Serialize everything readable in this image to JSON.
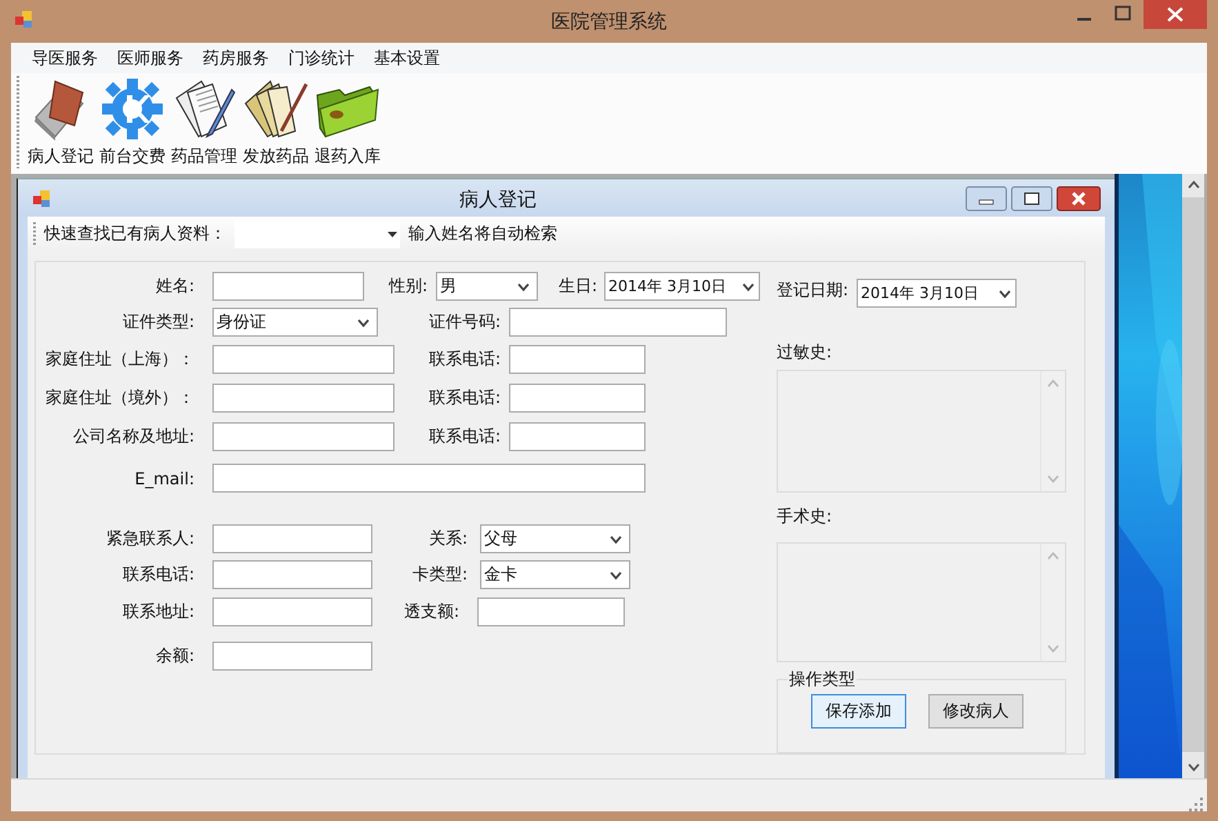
{
  "window": {
    "title": "医院管理系统"
  },
  "menu": [
    "导医服务",
    "医师服务",
    "药房服务",
    "门诊统计",
    "基本设置"
  ],
  "toolbar": [
    "病人登记",
    "前台交费",
    "药品管理",
    "发放药品",
    "退药入库"
  ],
  "child_window": {
    "title": "病人登记"
  },
  "quick_search": {
    "label": "快速查找已有病人资料：",
    "hint": "输入姓名将自动检索"
  },
  "form": {
    "rows": [
      [
        {
          "label": "姓名:",
          "kind": "input"
        },
        {
          "label": "性别:",
          "kind": "select",
          "value": "男"
        },
        {
          "label": "生日:",
          "kind": "date",
          "value": "2014年 3月10日"
        }
      ],
      [
        {
          "label": "证件类型:",
          "kind": "select",
          "value": "身份证"
        },
        {
          "label": "证件号码:",
          "kind": "input"
        }
      ],
      [
        {
          "label": "家庭住址（上海）：",
          "kind": "input"
        },
        {
          "label": "联系电话:",
          "kind": "input"
        }
      ],
      [
        {
          "label": "家庭住址（境外）：",
          "kind": "input"
        },
        {
          "label": "联系电话:",
          "kind": "input"
        }
      ],
      [
        {
          "label": "公司名称及地址:",
          "kind": "input"
        },
        {
          "label": "联系电话:",
          "kind": "input"
        }
      ],
      [
        {
          "label": "E_mail:",
          "kind": "input"
        }
      ],
      [
        {
          "label": "紧急联系人:",
          "kind": "input"
        },
        {
          "label": "关系:",
          "kind": "select",
          "value": "父母"
        }
      ],
      [
        {
          "label": "联系电话:",
          "kind": "input"
        },
        {
          "label": "卡类型:",
          "kind": "select",
          "value": "金卡"
        }
      ],
      [
        {
          "label": "联系地址:",
          "kind": "input"
        },
        {
          "label": "透支额:",
          "kind": "input"
        }
      ],
      [
        {
          "label": "余额:",
          "kind": "input"
        }
      ]
    ]
  },
  "side": {
    "reg_date_label": "登记日期:",
    "reg_date": "2014年 3月10日",
    "allergy_label": "过敏史:",
    "surgery_label": "手术史:"
  },
  "actions": {
    "title": "操作类型",
    "buttons": [
      {
        "label": "保存添加",
        "focused": true
      },
      {
        "label": "修改病人",
        "focused": false
      }
    ]
  }
}
